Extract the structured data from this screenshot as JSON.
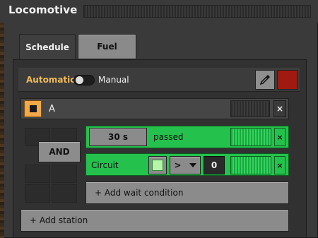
{
  "window": {
    "title": "Locomotive"
  },
  "tabs": [
    {
      "label": "Schedule",
      "active": true
    },
    {
      "label": "Fuel",
      "active": false
    }
  ],
  "mode": {
    "automatic_label": "Automatic",
    "manual_label": "Manual"
  },
  "station": {
    "name": "A"
  },
  "condition_logic": {
    "label": "AND"
  },
  "conditions": [
    {
      "time_value": "30 s",
      "text": "passed"
    },
    {
      "label": "Circuit",
      "comparator": ">",
      "constant": "0"
    }
  ],
  "buttons": {
    "add_wait_condition": "+ Add wait condition",
    "add_station": "+ Add station",
    "close_glyph": "×"
  },
  "colors": {
    "accent_orange": "#f2a94a",
    "condition_green": "#24c24c",
    "stop_red": "#a11a10"
  }
}
